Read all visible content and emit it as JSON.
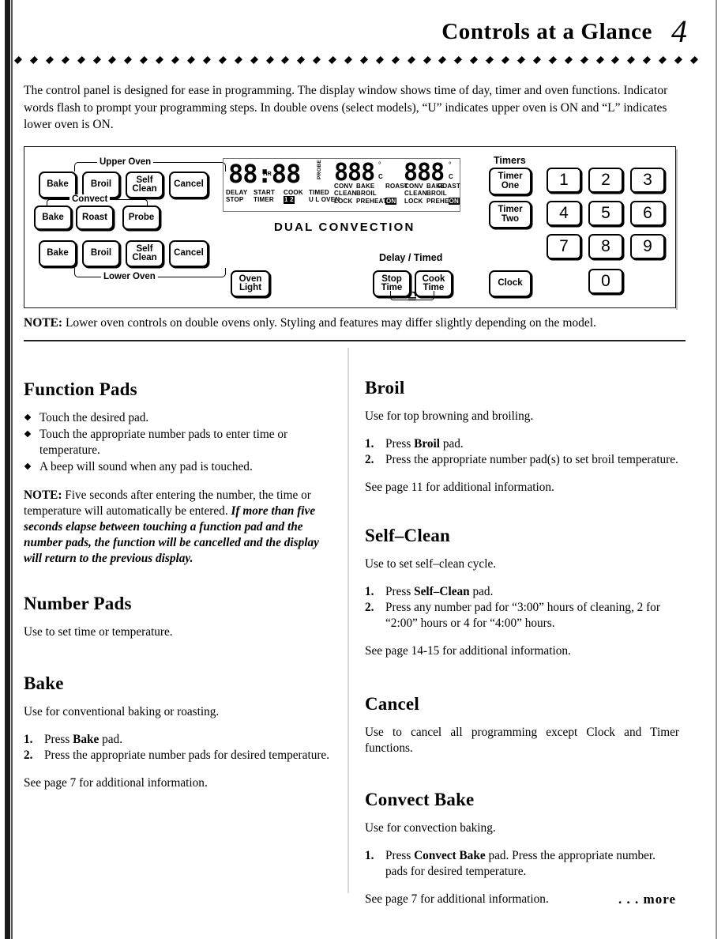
{
  "header": {
    "title": "Controls at a Glance",
    "page_number": "4"
  },
  "intro": "The control panel is designed for ease in programming. The display window shows time of day, timer and oven functions. Indicator words flash to prompt your programming steps. In double ovens (select models), “U” indicates upper oven is ON and “L” indicates lower oven is ON.",
  "panel": {
    "group_upper_oven": "Upper Oven",
    "group_convect": "Convect",
    "group_lower_oven": "Lower Oven",
    "group_timers": "Timers",
    "group_delay_timed": "Delay / Timed",
    "brand_text": "DUAL CONVECTION",
    "upper_pads": [
      "Bake",
      "Broil",
      "Self\nClean",
      "Cancel"
    ],
    "upper_pad_1": "Bake",
    "upper_pad_2": "Broil",
    "upper_pad_3_l1": "Self",
    "upper_pad_3_l2": "Clean",
    "upper_pad_4": "Cancel",
    "convect_pad_1": "Bake",
    "convect_pad_2": "Roast",
    "convect_pad_3": "Probe",
    "lower_pad_1": "Bake",
    "lower_pad_2": "Broil",
    "lower_pad_3_l1": "Self",
    "lower_pad_3_l2": "Clean",
    "lower_pad_4": "Cancel",
    "oven_light_l1": "Oven",
    "oven_light_l2": "Light",
    "stop_time_l1": "Stop",
    "stop_time_l2": "Time",
    "cook_time_l1": "Cook",
    "cook_time_l2": "Time",
    "timer_one_l1": "Timer",
    "timer_one_l2": "One",
    "timer_two_l1": "Timer",
    "timer_two_l2": "Two",
    "clock_pad": "Clock",
    "number_pads": [
      "1",
      "2",
      "3",
      "4",
      "5",
      "6",
      "7",
      "8",
      "9",
      "0"
    ],
    "display": {
      "clock_digits": "88:88",
      "hr_indicator": "HR",
      "oven1_digits": "888",
      "oven2_digits": "888",
      "degree_c": "C",
      "degree_symbol": "°",
      "probe_label": "PROBE",
      "left_labels": [
        {
          "top": "DELAY",
          "bottom": "STOP"
        },
        {
          "top": "START",
          "bottom": "TIMER"
        },
        {
          "top": "COOK",
          "bottom": "1 2"
        },
        {
          "top": "TIMED",
          "bottom": "U L OVEN"
        }
      ],
      "oven_labels": [
        {
          "l1": "CONV",
          "l2": "CLEAN",
          "l3": "LOCK"
        },
        {
          "l1": "BAKE",
          "l2": "BROIL",
          "l3": "PREHEAT"
        },
        {
          "l1": "ROAST",
          "l2": "",
          "l3": "ON"
        }
      ]
    }
  },
  "note_under_panel_label": "NOTE:",
  "note_under_panel_text": " Lower oven controls on double ovens only. Styling and features may differ slightly depending on the model.",
  "left_column": {
    "function_pads": {
      "heading": "Function Pads",
      "bullets": [
        "Touch the desired pad.",
        "Touch the appropriate number pads to enter time or temperature.",
        "A beep will sound when any pad is touched."
      ],
      "note_label": "NOTE:",
      "note_plain": "  Five seconds after entering the number, the time or temperature will automatically be entered. ",
      "note_italic": "If more than five seconds elapse between touching a function pad and the number pads, the function will be cancelled and the display will return to the previous display."
    },
    "number_pads": {
      "heading": "Number Pads",
      "body": "Use to set time or temperature."
    },
    "bake": {
      "heading": "Bake",
      "body": "Use for conventional baking or roasting.",
      "steps": [
        {
          "n": "1.",
          "pre": "Press ",
          "bold": "Bake",
          "post": " pad."
        },
        {
          "n": "2.",
          "pre": "Press the appropriate number pads for desired temperature.",
          "bold": "",
          "post": ""
        }
      ],
      "see_page": "See page 7 for additional information."
    }
  },
  "right_column": {
    "broil": {
      "heading": "Broil",
      "body": "Use for top browning and broiling.",
      "steps": [
        {
          "n": "1.",
          "pre": "Press ",
          "bold": "Broil",
          "post": " pad."
        },
        {
          "n": "2.",
          "pre": "Press the appropriate number pad(s) to set broil temperature.",
          "bold": "",
          "post": ""
        }
      ],
      "see_page": "See page 11 for additional information."
    },
    "self_clean": {
      "heading": "Self–Clean",
      "body": "Use to set self–clean cycle.",
      "steps": [
        {
          "n": "1.",
          "pre": "Press ",
          "bold": "Self–Clean",
          "post": " pad."
        },
        {
          "n": "2.",
          "pre": "Press any number pad for “3:00” hours of cleaning, 2 for “2:00” hours or 4 for “4:00” hours.",
          "bold": "",
          "post": ""
        }
      ],
      "see_page": "See page 14-15 for additional information."
    },
    "cancel": {
      "heading": "Cancel",
      "body": "Use to cancel all programming except Clock and Timer functions."
    },
    "convect_bake": {
      "heading": "Convect Bake",
      "body": "Use for convection baking.",
      "steps": [
        {
          "n": "1.",
          "pre": "Press ",
          "bold": "Convect Bake",
          "post": " pad.  Press the appropriate number. pads for desired temperature."
        }
      ],
      "see_page": "See page 7 for additional information."
    }
  },
  "footer": {
    "more": ". . . more"
  }
}
